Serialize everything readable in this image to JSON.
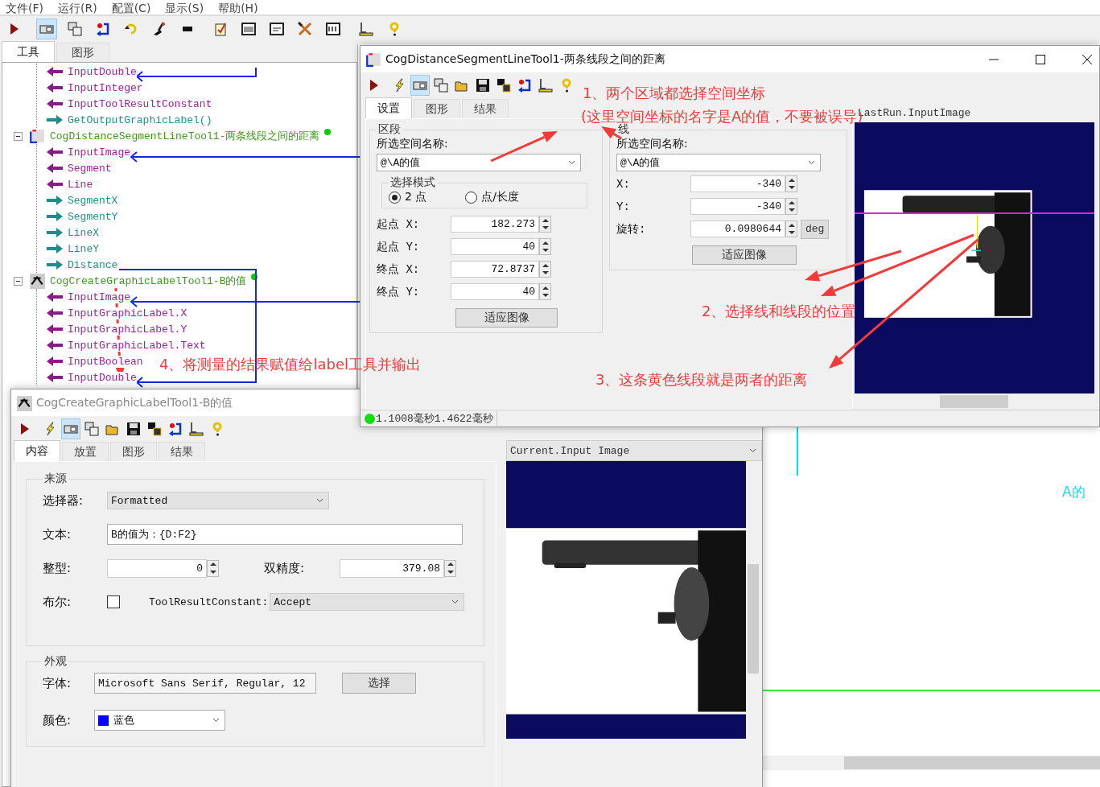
{
  "menu": [
    {
      "label": "文件(F)"
    },
    {
      "label": "运行(R)"
    },
    {
      "label": "配置(C)"
    },
    {
      "label": "显示(S)"
    },
    {
      "label": "帮助(H)"
    }
  ],
  "toolbar": [
    {
      "kind": "run",
      "selected": false
    },
    {
      "kind": "panel",
      "selected": true
    },
    {
      "kind": "panels",
      "selected": false
    },
    {
      "kind": "export",
      "selected": false
    },
    {
      "kind": "refresh",
      "selected": false
    },
    {
      "kind": "brush",
      "selected": false
    },
    {
      "kind": "tape",
      "selected": false
    },
    {
      "kind": "clipboard",
      "selected": false
    },
    {
      "kind": "counter",
      "selected": false
    },
    {
      "kind": "display",
      "selected": false
    },
    {
      "kind": "tools",
      "selected": false
    },
    {
      "kind": "monitor",
      "selected": false
    },
    {
      "kind": "ruler",
      "selected": false
    },
    {
      "kind": "help",
      "selected": false
    }
  ],
  "tool_tabs": [
    {
      "label": "工具",
      "selected": true
    },
    {
      "label": "图形",
      "selected": false
    }
  ],
  "tree": [
    {
      "kind": "group",
      "children": [
        {
          "kind": "input",
          "label": "InputDouble"
        },
        {
          "kind": "input",
          "label": "InputInteger"
        },
        {
          "kind": "input",
          "label": "InputToolResultConstant"
        },
        {
          "kind": "output",
          "label": "GetOutputGraphicLabel()"
        }
      ]
    },
    {
      "kind": "tool",
      "label": "CogDistanceSegmentLineTool1-两条线段之间的距离",
      "expanded": true,
      "ok": true,
      "children": [
        {
          "kind": "input",
          "label": "InputImage"
        },
        {
          "kind": "input",
          "label": "Segment"
        },
        {
          "kind": "input",
          "label": "Line"
        },
        {
          "kind": "output",
          "label": "SegmentX"
        },
        {
          "kind": "output",
          "label": "SegmentY"
        },
        {
          "kind": "output",
          "label": "LineX"
        },
        {
          "kind": "output",
          "label": "LineY"
        },
        {
          "kind": "output",
          "label": "Distance"
        }
      ]
    },
    {
      "kind": "tool",
      "label": "CogCreateGraphicLabelTool1-B的值",
      "expanded": true,
      "ok": true,
      "children": [
        {
          "kind": "input",
          "label": "InputImage"
        },
        {
          "kind": "input",
          "label": "InputGraphicLabel.X"
        },
        {
          "kind": "input",
          "label": "InputGraphicLabel.Y"
        },
        {
          "kind": "input",
          "label": "InputGraphicLabel.Text"
        },
        {
          "kind": "input",
          "label": "InputBoolean"
        },
        {
          "kind": "input",
          "label": "InputDouble"
        }
      ]
    }
  ],
  "canvas": {
    "label": "A的"
  },
  "distance_dialog": {
    "title": "CogDistanceSegmentLineTool1-两条线段之间的距离",
    "active": true,
    "toolbar": [
      {
        "kind": "run",
        "selected": false
      },
      {
        "kind": "lightning",
        "selected": false
      },
      {
        "kind": "panel",
        "selected": true
      },
      {
        "kind": "panels",
        "selected": false
      },
      {
        "kind": "folder",
        "selected": false
      },
      {
        "kind": "save",
        "selected": false
      },
      {
        "kind": "copy",
        "selected": false
      },
      {
        "kind": "export",
        "selected": false
      },
      {
        "kind": "ruler",
        "selected": false
      },
      {
        "kind": "help",
        "selected": false
      }
    ],
    "tabs": [
      {
        "label": "设置",
        "selected": true
      },
      {
        "label": "图形",
        "selected": false
      },
      {
        "label": "结果",
        "selected": false
      }
    ],
    "segment": {
      "title": "区段",
      "space_label": "所选空间名称:",
      "space": "@\\A的值",
      "mode": {
        "title": "选择模式",
        "options": [
          {
            "label": "2 点",
            "selected": true
          },
          {
            "label": "点/长度",
            "selected": false
          }
        ]
      },
      "fields": [
        {
          "label": "起点 X:",
          "value": "182.273"
        },
        {
          "label": "起点 Y:",
          "value": "40"
        },
        {
          "label": "终点 X:",
          "value": "72.8737"
        },
        {
          "label": "终点 Y:",
          "value": "40"
        }
      ],
      "button": "适应图像"
    },
    "line": {
      "title": "线",
      "space_label": "所选空间名称:",
      "space": "@\\A的值",
      "fields": [
        {
          "label": "X:",
          "value": "-340"
        },
        {
          "label": "Y:",
          "value": "-340"
        },
        {
          "label": "旋转:",
          "value": "0.0980644",
          "unit": "deg"
        }
      ],
      "button": "适应图像"
    },
    "image": {
      "title": "LastRun.InputImage"
    },
    "status": {
      "ok": true,
      "times": [
        "1.1008毫秒",
        "1.4622毫秒"
      ]
    }
  },
  "label_dialog": {
    "title": "CogCreateGraphicLabelTool1-B的值",
    "active": false,
    "toolbar": [
      {
        "kind": "run",
        "selected": false
      },
      {
        "kind": "lightning",
        "selected": false
      },
      {
        "kind": "panel",
        "selected": true
      },
      {
        "kind": "panels",
        "selected": false
      },
      {
        "kind": "folder",
        "selected": false
      },
      {
        "kind": "save",
        "selected": false
      },
      {
        "kind": "copy",
        "selected": false
      },
      {
        "kind": "export",
        "selected": false
      },
      {
        "kind": "ruler",
        "selected": false
      },
      {
        "kind": "help",
        "selected": false
      }
    ],
    "tabs": [
      {
        "label": "内容",
        "selected": true
      },
      {
        "label": "放置",
        "selected": false
      },
      {
        "label": "图形",
        "selected": false
      },
      {
        "label": "结果",
        "selected": false
      }
    ],
    "source": {
      "title": "来源",
      "selector_label": "选择器:",
      "selector": "Formatted",
      "text_label": "文本:",
      "text": "B的值为：{D:F2}",
      "int_label": "整型:",
      "int": "0",
      "double_label": "双精度:",
      "double": "379.08",
      "bool_label": "布尔:",
      "bool_checked": false,
      "result_label": "ToolResultConstant:",
      "result": "Accept"
    },
    "appearance": {
      "title": "外观",
      "font_label": "字体:",
      "font": "Microsoft Sans Serif, Regular, 12",
      "font_button": "选择",
      "color_label": "颜色:",
      "color_name": "蓝色",
      "color": "#0000ff"
    },
    "image": {
      "title": "Current.Input Image"
    }
  },
  "annotations": [
    {
      "text": "1、两个区域都选择空间坐标"
    },
    {
      "text": "(这里空间坐标的名字是A的值，不要被误导)"
    },
    {
      "text": "2、选择线和线段的位置"
    },
    {
      "text": "3、这条黄色线段就是两者的距离"
    },
    {
      "text": "4、将测量的结果赋值给label工具并输出"
    }
  ]
}
